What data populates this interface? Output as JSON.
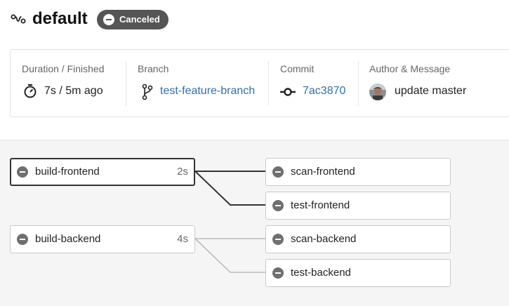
{
  "header": {
    "title": "default",
    "status_badge": "Canceled"
  },
  "info": {
    "duration": {
      "label": "Duration / Finished",
      "value": "7s / 5m ago"
    },
    "branch": {
      "label": "Branch",
      "value": "test-feature-branch"
    },
    "commit": {
      "label": "Commit",
      "value": "7ac3870"
    },
    "author": {
      "label": "Author & Message",
      "value": "update master"
    }
  },
  "graph": {
    "stages": [
      {
        "name": "build-frontend",
        "duration": "2s",
        "status": "canceled",
        "selected": true
      },
      {
        "name": "scan-frontend",
        "duration": "",
        "status": "canceled",
        "selected": false
      },
      {
        "name": "test-frontend",
        "duration": "",
        "status": "canceled",
        "selected": false
      },
      {
        "name": "build-backend",
        "duration": "4s",
        "status": "canceled",
        "selected": false
      },
      {
        "name": "scan-backend",
        "duration": "",
        "status": "canceled",
        "selected": false
      },
      {
        "name": "test-backend",
        "duration": "",
        "status": "canceled",
        "selected": false
      }
    ]
  },
  "colors": {
    "badge_bg": "#555555",
    "link": "#2f6fb0",
    "status_icon": "#6f6f6f",
    "graph_bg": "#f5f5f5"
  }
}
